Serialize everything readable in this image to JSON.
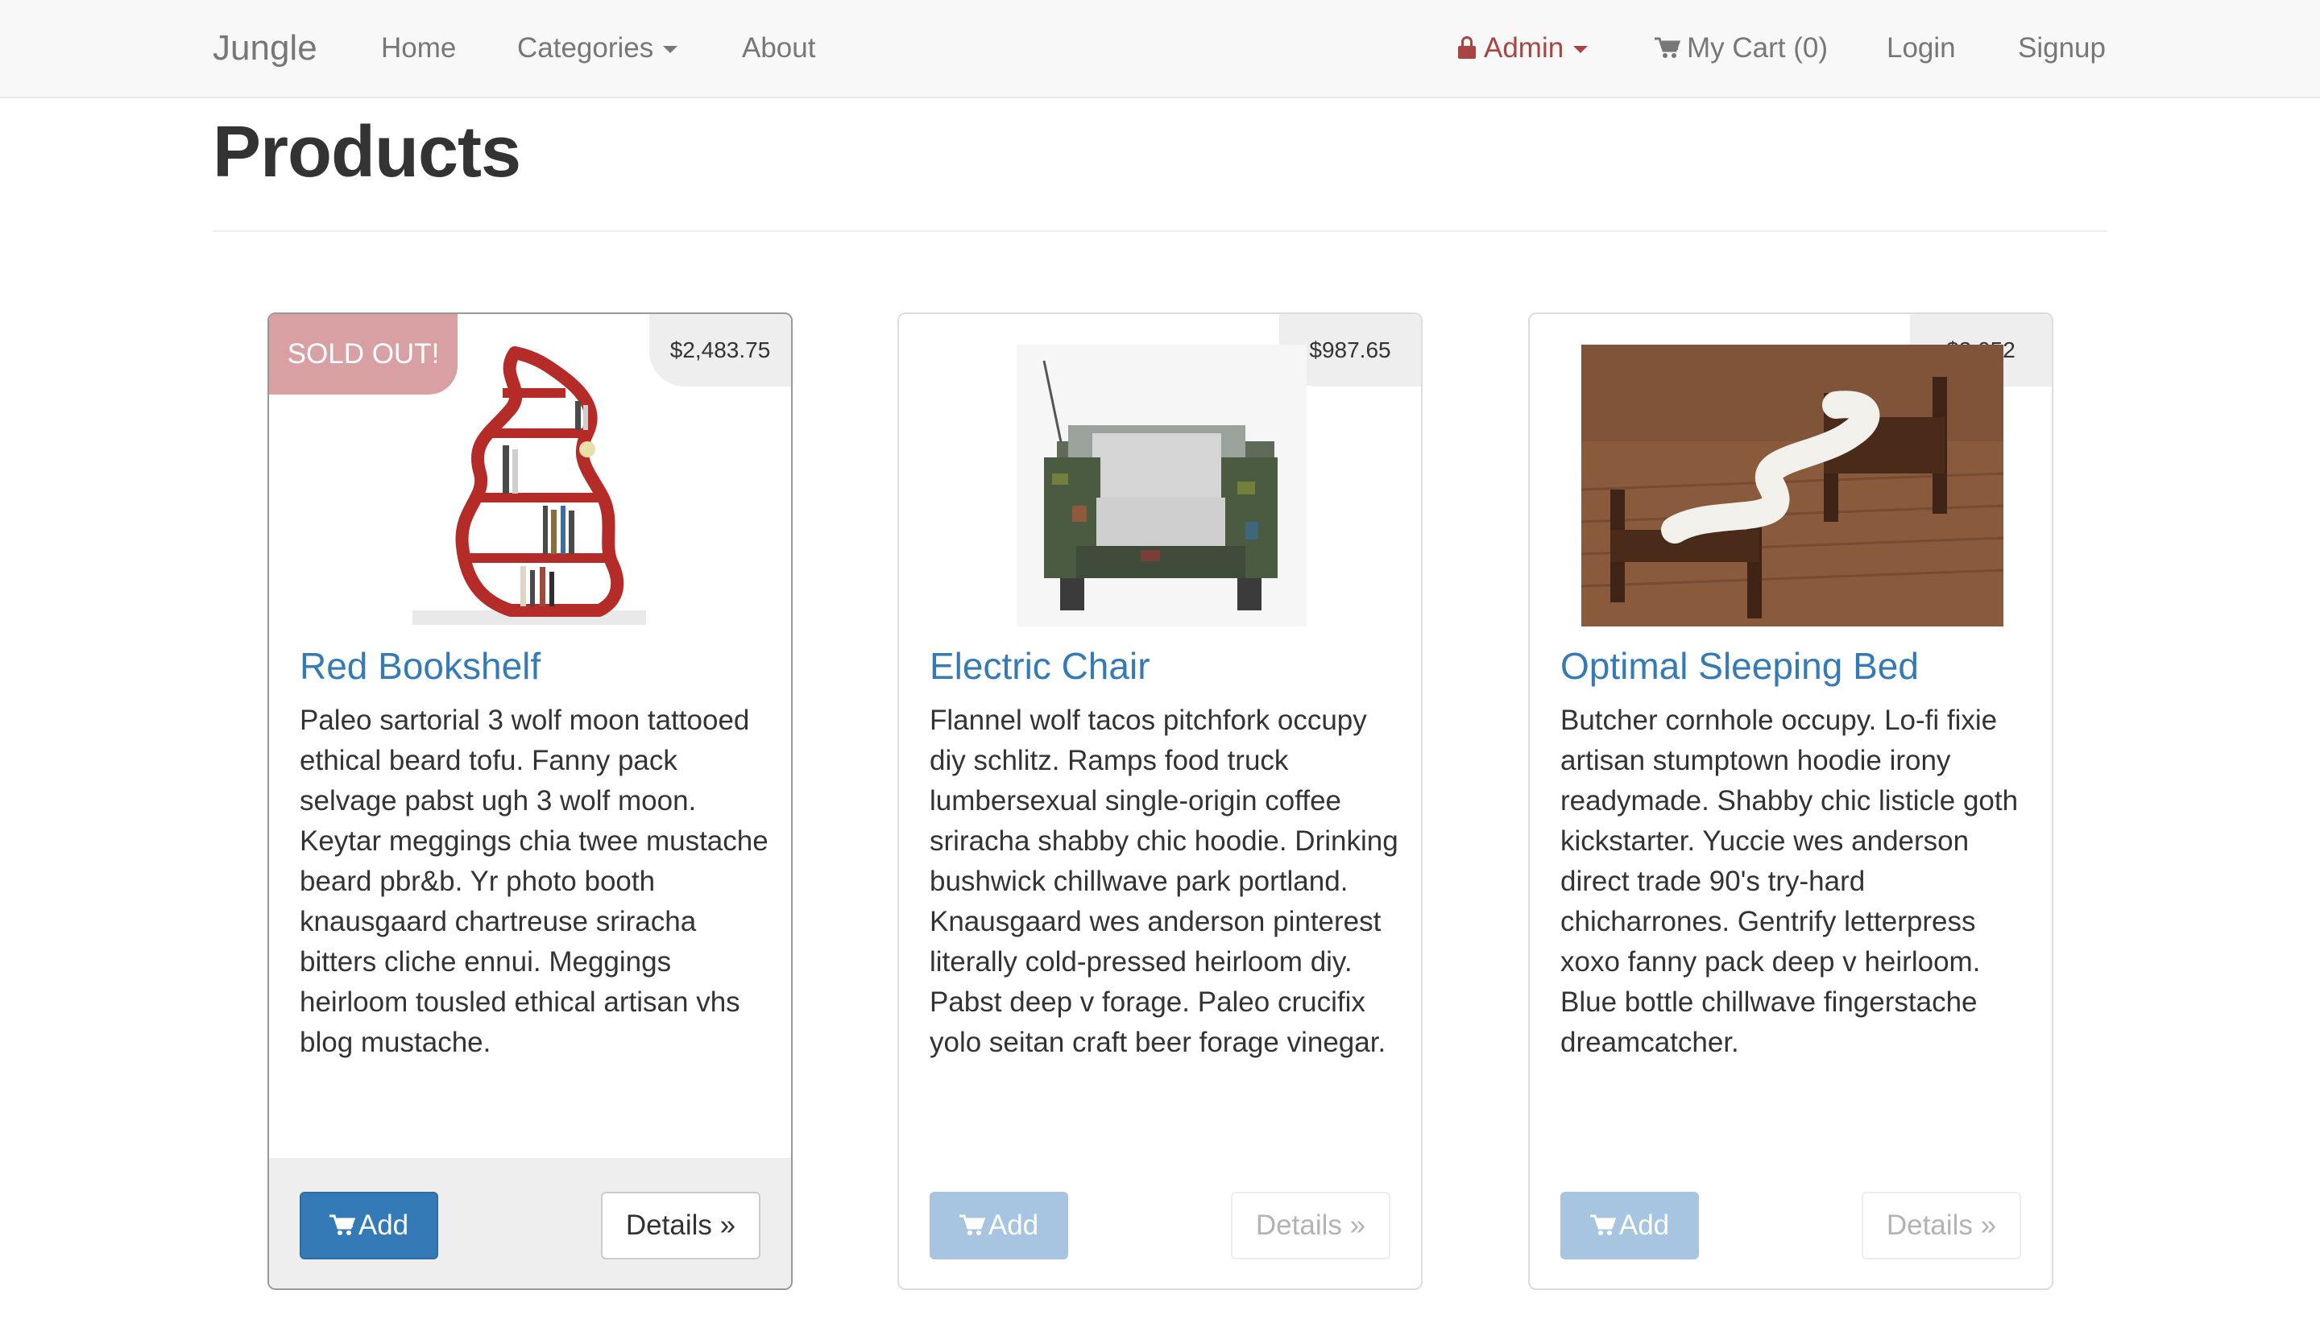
{
  "navbar": {
    "brand": "Jungle",
    "home": "Home",
    "categories": "Categories",
    "about": "About",
    "admin": "Admin",
    "cart": "My Cart (0)",
    "login": "Login",
    "signup": "Signup"
  },
  "page": {
    "title": "Products"
  },
  "products": [
    {
      "name": "Red Bookshelf",
      "price": "$2,483.75",
      "badge": "SOLD OUT!",
      "description": "Paleo sartorial 3 wolf moon tattooed ethical beard tofu. Fanny pack selvage pabst ugh 3 wolf moon. Keytar meggings chia twee mustache beard pbr&b. Yr photo booth knausgaard chartreuse sriracha bitters cliche ennui. Meggings heirloom tousled ethical artisan vhs blog mustache.",
      "add_label": "Add",
      "details_label": "Details »"
    },
    {
      "name": "Electric Chair",
      "price": "$987.65",
      "description": "Flannel wolf tacos pitchfork occupy diy schlitz. Ramps food truck lumbersexual single-origin coffee sriracha shabby chic hoodie. Drinking bushwick chillwave park portland. Knausgaard wes anderson pinterest literally cold-pressed heirloom diy. Pabst deep v forage. Paleo crucifix yolo seitan craft beer forage vinegar.",
      "add_label": "Add",
      "details_label": "Details »"
    },
    {
      "name": "Optimal Sleeping Bed",
      "price": "$3,052",
      "description": "Butcher cornhole occupy. Lo-fi fixie artisan stumptown hoodie irony readymade. Shabby chic listicle goth kickstarter. Yuccie wes anderson direct trade 90's try-hard chicharrones. Gentrify letterpress xoxo fanny pack deep v heirloom. Blue bottle chillwave fingerstache dreamcatcher.",
      "add_label": "Add",
      "details_label": "Details »"
    }
  ],
  "colors": {
    "link": "#337ab7",
    "admin": "#a94442",
    "sold_out_badge": "#d9a0a3",
    "primary_button": "#337ab7"
  }
}
